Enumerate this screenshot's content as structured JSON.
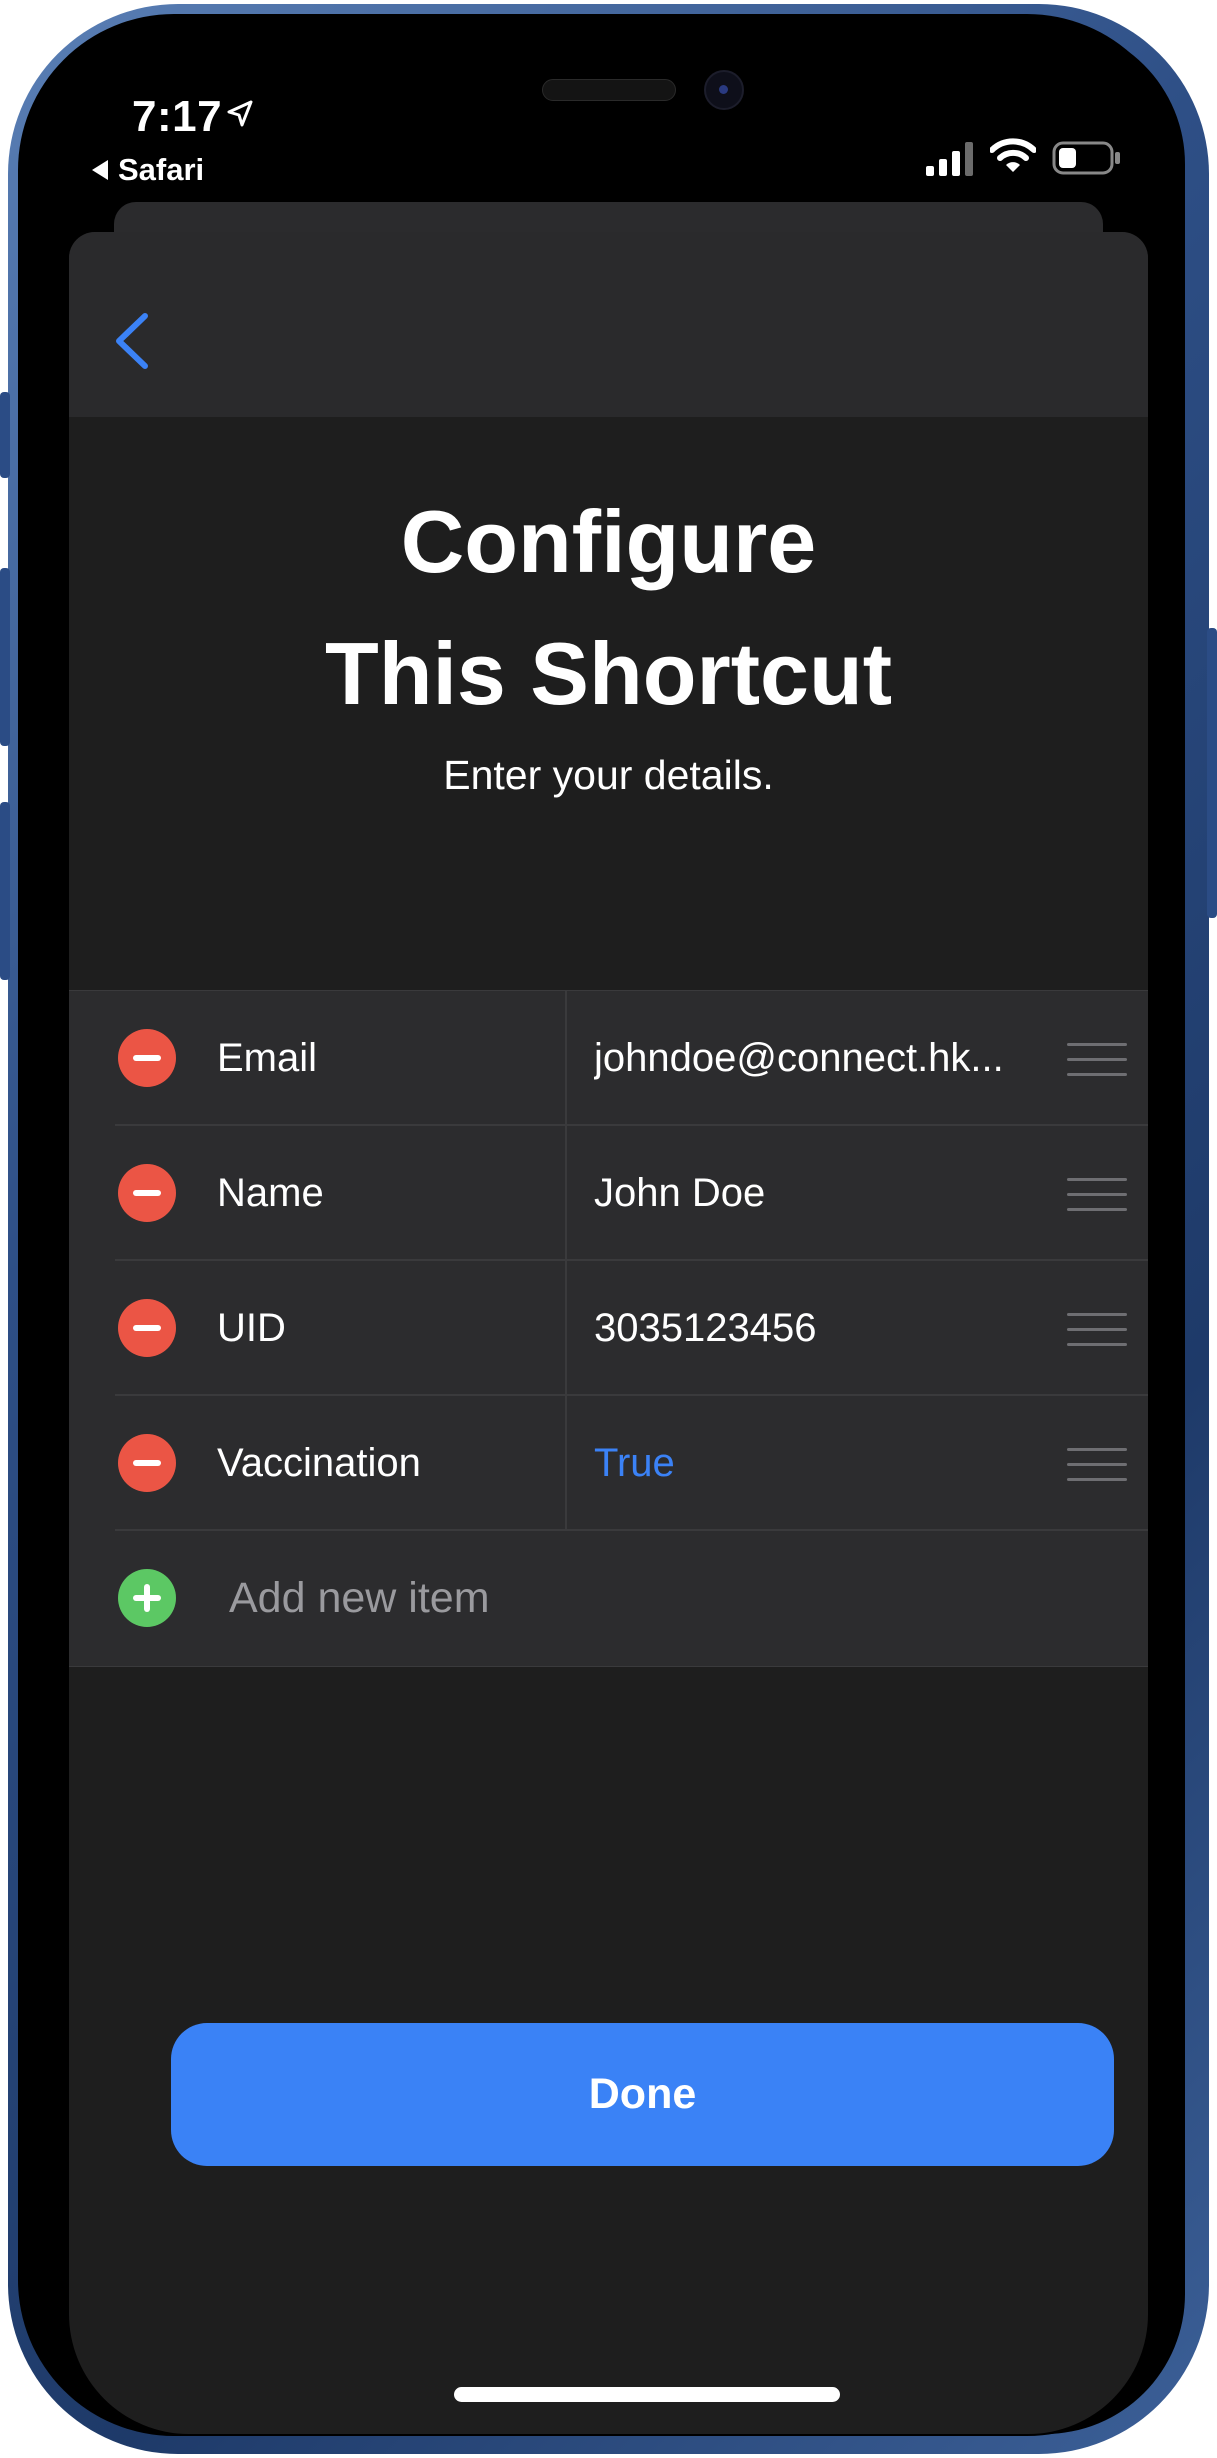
{
  "status_bar": {
    "time": "7:17",
    "back_app": "Safari",
    "signal_icon": "cellular-signal-icon",
    "wifi_icon": "wifi-icon",
    "battery_icon": "battery-icon"
  },
  "sheet": {
    "title": "Configure\nThis Shortcut",
    "subtitle": "Enter your details.",
    "items": [
      {
        "key": "Email",
        "value": "johndoe@connect.hk..."
      },
      {
        "key": "Name",
        "value": "John Doe"
      },
      {
        "key": "UID",
        "value": "3035123456"
      },
      {
        "key": "Vaccination",
        "value": "True"
      }
    ],
    "add_item_label": "Add new item",
    "done_label": "Done"
  },
  "colors": {
    "accent": "#3a82f6",
    "remove": "#eb5545",
    "add": "#5cc864",
    "frame": "#2e4f86"
  }
}
